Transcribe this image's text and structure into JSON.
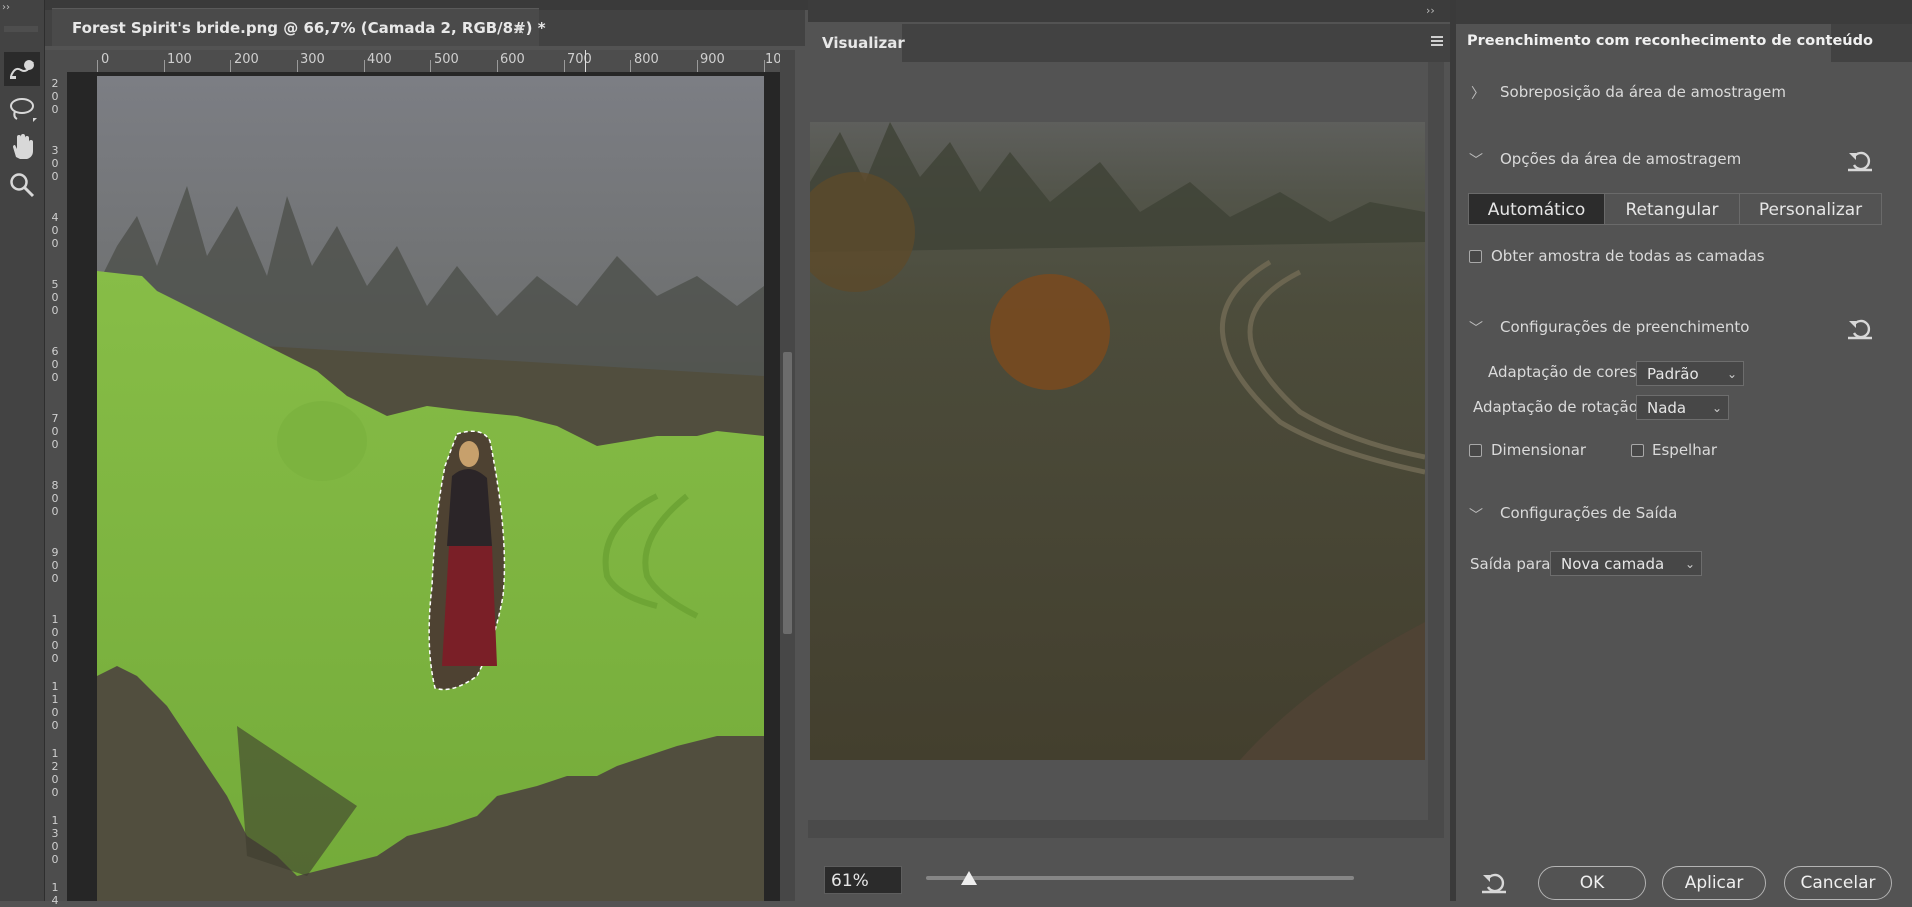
{
  "app": {
    "document_tab": "Forest Spirit's bride.png @ 66,7% (Camada 2, RGB/8#) *",
    "close_glyph": "×",
    "collapse_glyph": "››"
  },
  "ruler": {
    "horizontal_labels": [
      "0",
      "100",
      "200",
      "300",
      "400",
      "500",
      "600",
      "700",
      "800",
      "900",
      "10"
    ],
    "vertical_labels": [
      [
        "2",
        "0",
        "0"
      ],
      [
        "3",
        "0",
        "0"
      ],
      [
        "4",
        "0",
        "0"
      ],
      [
        "5",
        "0",
        "0"
      ],
      [
        "6",
        "0",
        "0"
      ],
      [
        "7",
        "0",
        "0"
      ],
      [
        "8",
        "0",
        "0"
      ],
      [
        "9",
        "0",
        "0"
      ],
      [
        "1",
        "0",
        "0",
        "0"
      ],
      [
        "1",
        "1",
        "0",
        "0"
      ],
      [
        "1",
        "2",
        "0",
        "0"
      ],
      [
        "1",
        "3",
        "0",
        "0"
      ],
      [
        "1",
        "4"
      ]
    ]
  },
  "tools": [
    "brush-select-icon",
    "lasso-icon",
    "hand-icon",
    "zoom-icon"
  ],
  "preview": {
    "tab_label": "Visualizar",
    "zoom_value": "61%",
    "zoom_fraction": 0.1
  },
  "content_aware_fill": {
    "title": "Preenchimento com reconhecimento de conteúdo",
    "sampling_overlay": "Sobreposição da área de amostragem",
    "sampling_options": "Opções da área de amostragem",
    "modes": [
      "Automático",
      "Retangular",
      "Personalizar"
    ],
    "active_mode": "Automático",
    "sample_all_layers": "Obter amostra de todas as camadas",
    "fill_settings": "Configurações de preenchimento",
    "color_adaptation_label": "Adaptação de cores",
    "color_adaptation_value": "Padrão",
    "rotation_adaptation_label": "Adaptação de rotação",
    "rotation_adaptation_value": "Nada",
    "scale_label": "Dimensionar",
    "mirror_label": "Espelhar",
    "output_settings": "Configurações de Saída",
    "output_to_label": "Saída para",
    "output_to_value": "Nova camada",
    "buttons": {
      "ok": "OK",
      "apply": "Aplicar",
      "cancel": "Cancelar"
    }
  },
  "colors": {
    "accent_green": "#7fb640",
    "panel_bg": "#535353",
    "dark_bg": "#262626"
  }
}
